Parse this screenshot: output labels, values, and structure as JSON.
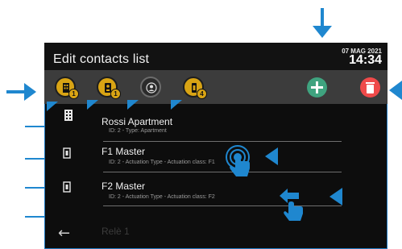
{
  "screen": {
    "title": "Edit contacts list",
    "date": "07 MAG 2021",
    "time": "14:34"
  },
  "toolbar": {
    "filters": [
      {
        "icon": "building-icon",
        "badge": "1",
        "active": true
      },
      {
        "icon": "door-panel-icon",
        "badge": "1",
        "active": true
      },
      {
        "icon": "user-circle-icon",
        "badge": "",
        "active": false
      },
      {
        "icon": "actuator-icon",
        "badge": "4",
        "active": true
      }
    ],
    "add_icon": "plus-icon",
    "delete_icon": "trash-icon",
    "colors": {
      "filter": "#d9a414",
      "add": "#3fa37f",
      "delete": "#ef4a4a"
    }
  },
  "contacts": [
    {
      "name": "Rossi Apartment",
      "detail": "ID: 2 - Type: Apartment",
      "icon": "building-icon"
    },
    {
      "name": "F1 Master",
      "detail": "ID: 2 - Actuation Type - Actuation class: F1",
      "icon": "actuator-icon"
    },
    {
      "name": "F2 Master",
      "detail": "ID: 2 - Actuation Type - Actuation class: F2",
      "icon": "actuator-icon"
    },
    {
      "name": "Relè 1",
      "detail": "",
      "icon": ""
    }
  ],
  "back_arrow": "←",
  "annotation_color": "#1f87cf"
}
